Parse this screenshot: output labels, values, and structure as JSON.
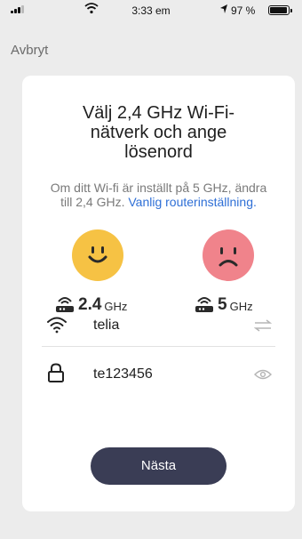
{
  "status_bar": {
    "time": "3:33 em",
    "battery_text": "97 %",
    "battery_level": 0.97
  },
  "nav": {
    "cancel_label": "Avbryt"
  },
  "card": {
    "title": "Välj 2,4 GHz Wi-Fi-nätverk och ange lösenord",
    "desc_prefix": "Om ditt Wi-fi är inställt på 5 GHz, ändra till 2,4 GHz. ",
    "desc_link": "Vanlig routerinställning.",
    "band_24_number": "2.4",
    "band_24_unit": "GHz",
    "band_5_number": "5",
    "band_5_unit": "GHz",
    "ssid_value": "telia",
    "password_value": "te123456",
    "next_label": "Nästa"
  },
  "icons": {
    "happy_face": "happy-face-icon",
    "sad_face": "sad-face-icon",
    "router": "router-icon",
    "wifi": "wifi-icon",
    "switch": "switch-arrows-icon",
    "lock": "lock-icon",
    "eye": "eye-icon"
  },
  "colors": {
    "accent_button": "#3a3d55",
    "link": "#2e6fd6",
    "happy": "#f6c244",
    "sad": "#f0838b"
  }
}
